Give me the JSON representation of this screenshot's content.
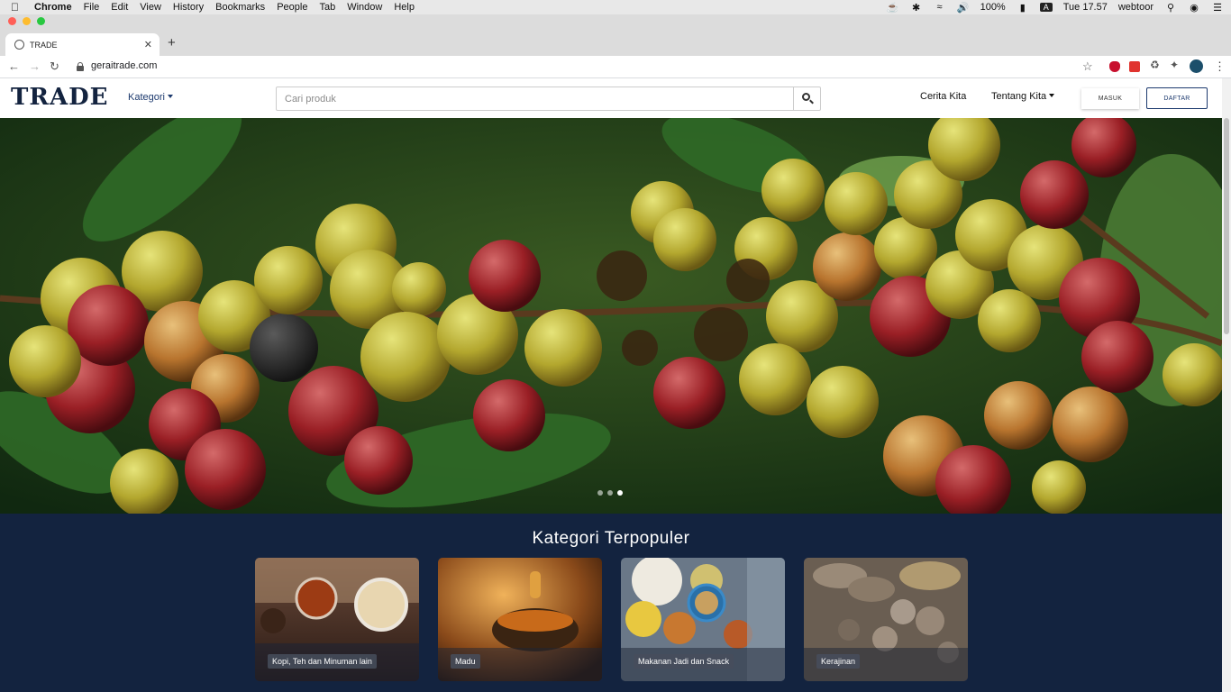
{
  "os_menubar": {
    "app": "Chrome",
    "menus": [
      "File",
      "Edit",
      "View",
      "History",
      "Bookmarks",
      "People",
      "Tab",
      "Window",
      "Help"
    ],
    "battery": "100%",
    "clock": "Tue 17.57",
    "user": "webtoor"
  },
  "browser": {
    "tab_title": "TRADE",
    "url": "geraitrade.com"
  },
  "site": {
    "logo": "TRADE",
    "kategori": "Kategori",
    "search_placeholder": "Cari produk",
    "cerita_kita": "Cerita Kita",
    "tentang_kita": "Tentang Kita",
    "masuk": "MASUK",
    "daftar": "DAFTAR"
  },
  "carousel": {
    "slides": 3,
    "active_slide": 3
  },
  "popular": {
    "title": "Kategori Terpopuler",
    "categories": [
      {
        "label": "Kopi, Teh dan Minuman lain"
      },
      {
        "label": "Madu"
      },
      {
        "label": "Makanan Jadi dan Snack"
      },
      {
        "label": "Kerajinan"
      }
    ]
  },
  "colors": {
    "brand_navy": "#13233f",
    "link_blue": "#1d3a6e"
  }
}
